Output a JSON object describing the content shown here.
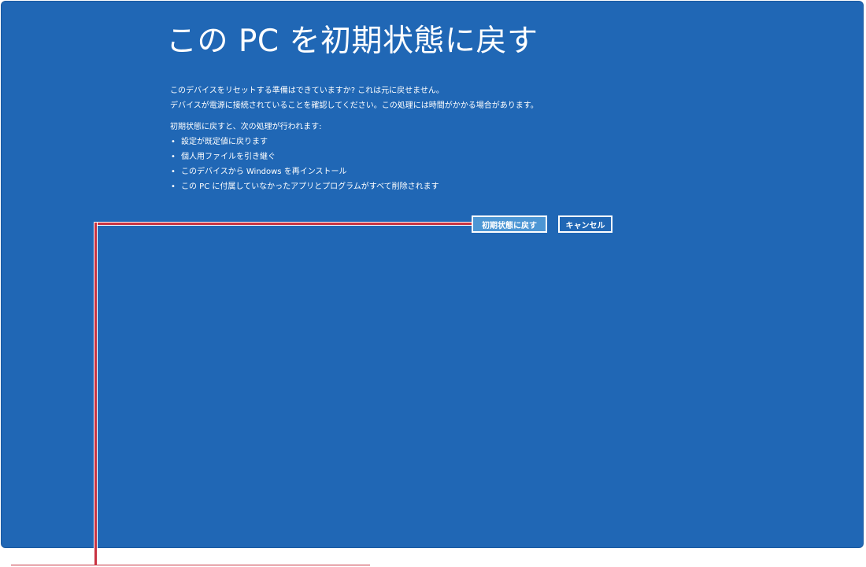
{
  "dialog": {
    "title": "この PC を初期状態に戻す",
    "intro_line1": "このデバイスをリセットする準備はできていますか? これは元に戻せません。",
    "intro_line2": "デバイスが電源に接続されていることを確認してください。この処理には時間がかかる場合があります。",
    "list_heading": "初期状態に戻すと、次の処理が行われます:",
    "bullet_glyph": "•",
    "bullets": [
      "設定が既定値に戻ります",
      "個人用ファイルを引き継ぐ",
      "このデバイスから Windows を再インストール",
      "この PC に付属していなかったアプリとプログラムがすべて削除されます"
    ]
  },
  "buttons": {
    "reset_label": "初期状態に戻す",
    "cancel_label": "キャンセル"
  },
  "colors": {
    "background": "#2067b5",
    "primary_button": "#4c96d4",
    "text": "#ffffff",
    "callout": "#c83241"
  }
}
